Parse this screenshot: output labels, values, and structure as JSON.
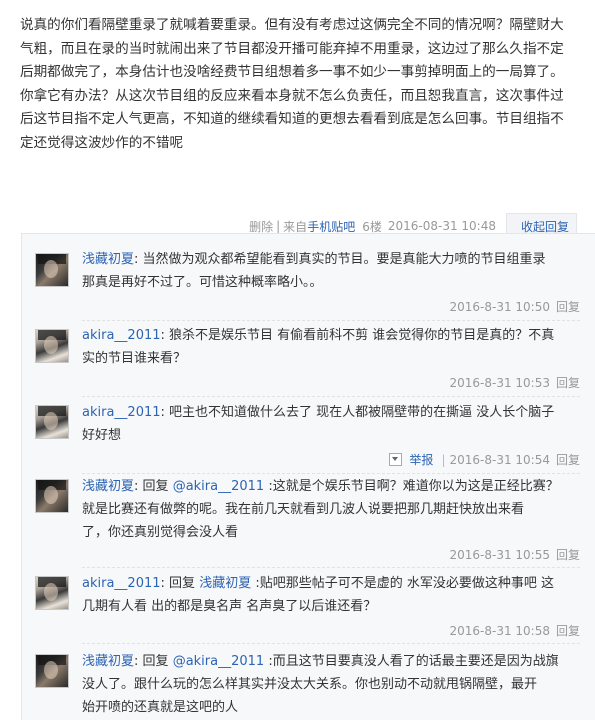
{
  "post": {
    "lines": [
      "说真的你们看隔壁重录了就喊着要重录。但有没有考虑过这俩完全不同的情况啊？隔壁财大",
      "气粗，而且在录的当时就闹出来了节目都没开播可能弃掉不用重录，这边过了那么久指不定",
      "后期都做完了，本身估计也没啥经费节目组想着多一事不如少一事剪掉明面上的一局算了。",
      "你拿它有办法？从这次节目组的反应来看本身就不怎么负责任，而且恕我直言，这次事件过",
      "后这节目指不定人气更高，不知道的继续看知道的更想去看看到底是怎么回事。节目组指不",
      "定还觉得这波炒作的不错呢"
    ],
    "meta": {
      "delete": "删除",
      "sep": "|",
      "from": "来自",
      "source": "手机贴吧",
      "floor": "6楼",
      "time": "2016-08-31 10:48",
      "collapse": "收起回复"
    }
  },
  "replies": [
    {
      "user": "浅藏初夏",
      "lines": [
        "当然做为观众都希望能看到真实的节目。要是真能大力喷的节目组重录",
        "那真是再好不过了。可惜这种概率略小。。"
      ],
      "time": "2016-8-31 10:50",
      "reply": "回复"
    },
    {
      "user": "akira__2011",
      "lines": [
        "狼杀不是娱乐节目 有偷看前科不剪 谁会觉得你的节目是真的？不真",
        "实的节目谁来看？"
      ],
      "time": "2016-8-31 10:53",
      "reply": "回复"
    },
    {
      "user": "akira__2011",
      "lines": [
        "吧主也不知道做什么去了 现在人都被隔壁带的在撕逼 没人长个脑子",
        "好好想"
      ],
      "time": "2016-8-31 10:54",
      "reply": "回复",
      "report": "举报"
    },
    {
      "user": "浅藏初夏",
      "reply_word": "回复",
      "target": "@akira__2011",
      "lines": [
        ":这就是个娱乐节目啊？难道你以为这是正经比赛？",
        "就是比赛还有做弊的呢。我在前几天就看到几波人说要把那几期赶快放出来看",
        "了，你还真别觉得会没人看"
      ],
      "time": "2016-8-31 10:55",
      "reply": "回复"
    },
    {
      "user": "akira__2011",
      "reply_word": "回复",
      "target": "浅藏初夏",
      "lines": [
        ":贴吧那些帖子可不是虚的 水军没必要做这种事吧 这",
        "几期有人看 出的都是臭名声 名声臭了以后谁还看？"
      ],
      "time": "2016-8-31 10:58",
      "reply": "回复"
    },
    {
      "user": "浅藏初夏",
      "reply_word": "回复",
      "target": "@akira__2011",
      "lines": [
        ":而且这节目要真没人看了的话最主要还是因为战旗",
        "没人了。跟什么玩的怎么样其实并没太大关系。你也别动不动就甩锅隔壁，最开",
        "始开喷的还真就是这吧的人"
      ]
    }
  ]
}
